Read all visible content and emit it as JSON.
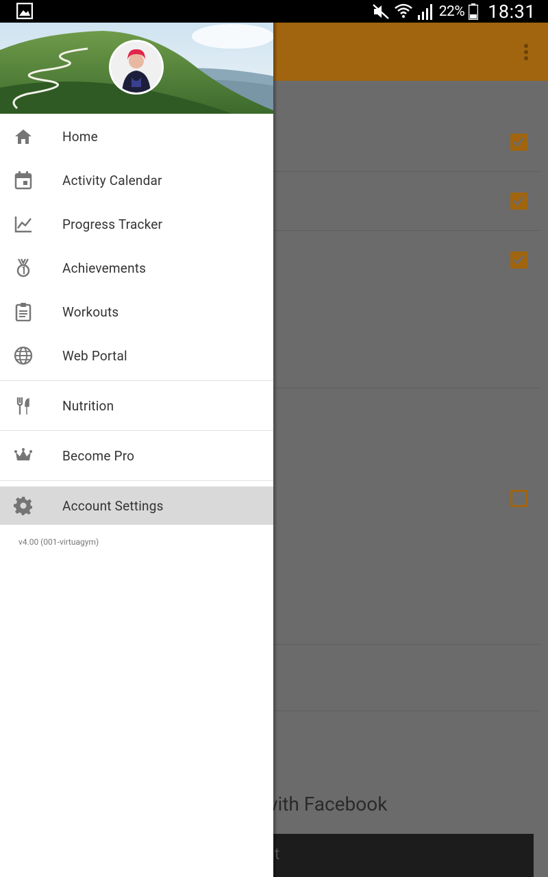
{
  "status_bar": {
    "battery_percent": "22%",
    "time": "18:31",
    "icons": [
      "gallery-icon",
      "mute-icon",
      "wifi-icon",
      "signal-icon",
      "battery-icon"
    ]
  },
  "drawer": {
    "menu_group_1": [
      {
        "label": "Home",
        "icon": "home-icon"
      },
      {
        "label": "Activity Calendar",
        "icon": "calendar-icon"
      },
      {
        "label": "Progress Tracker",
        "icon": "chart-icon"
      },
      {
        "label": "Achievements",
        "icon": "medal-icon"
      },
      {
        "label": "Workouts",
        "icon": "clipboard-icon"
      },
      {
        "label": "Web Portal",
        "icon": "globe-icon"
      }
    ],
    "nutrition": {
      "label": "Nutrition",
      "icon": "fork-knife-icon"
    },
    "become_pro": {
      "label": "Become Pro",
      "icon": "crown-icon"
    },
    "account_settings": {
      "label": "Account Settings",
      "icon": "gear-icon",
      "selected": true
    },
    "version": "v4.00 (001-virtuagym)"
  },
  "background": {
    "facebook_text": "n with Facebook",
    "logout_text": "gout",
    "checkboxes": [
      true,
      true,
      true,
      false
    ]
  },
  "colors": {
    "accent": "#F0980F",
    "accent_dimmed": "#A0650E",
    "scrim_bg": "#6B6B6B",
    "selected_row": "#D9D9D9",
    "icon_gray": "#757575"
  }
}
